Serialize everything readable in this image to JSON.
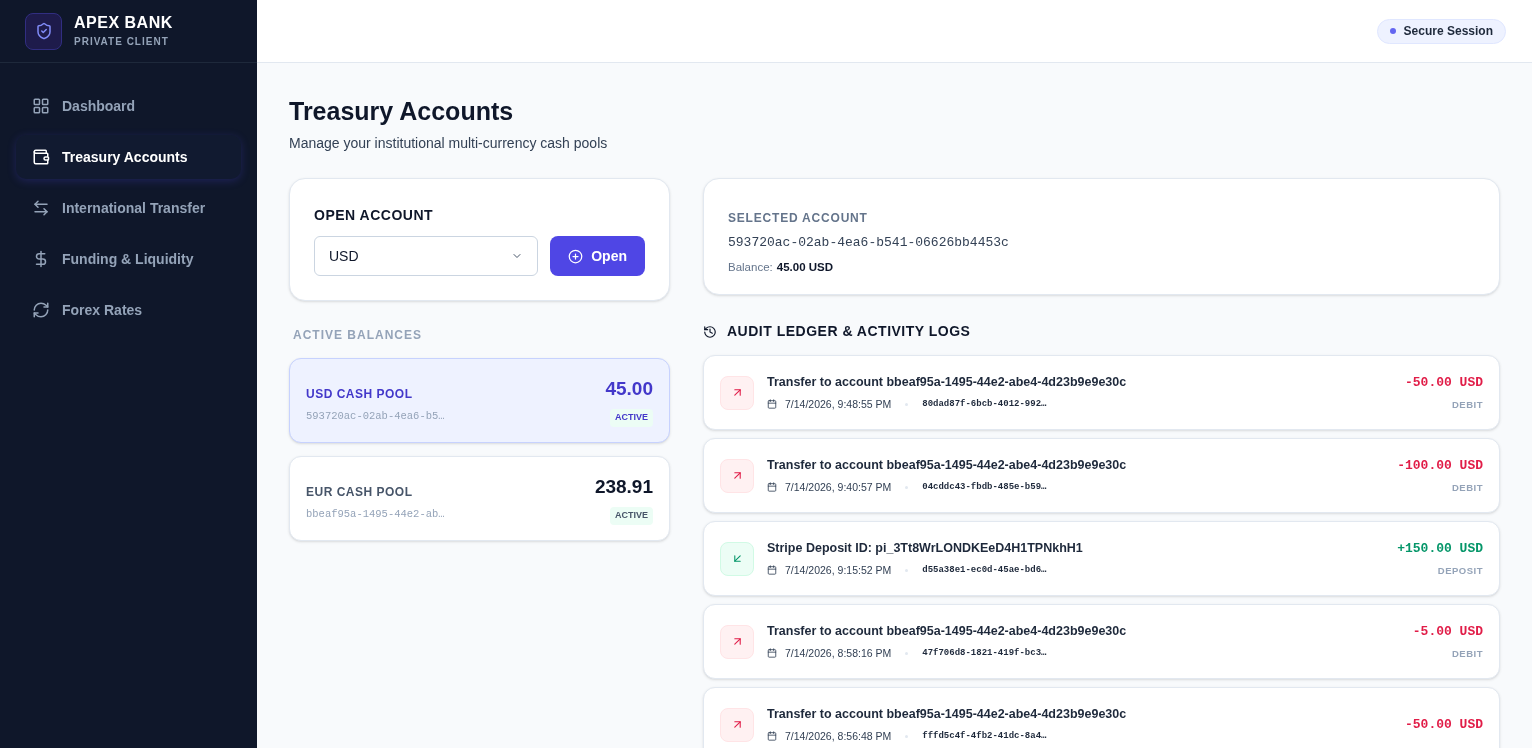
{
  "brand": {
    "name": "APEX BANK",
    "subtitle": "PRIVATE CLIENT"
  },
  "nav": [
    {
      "label": "Dashboard",
      "kind": "dashboard",
      "selected": false
    },
    {
      "label": "Treasury Accounts",
      "kind": "wallet",
      "selected": true
    },
    {
      "label": "International Transfer",
      "kind": "transfer",
      "selected": false
    },
    {
      "label": "Funding & Liquidity",
      "kind": "dollar",
      "selected": false
    },
    {
      "label": "Forex Rates",
      "kind": "refresh",
      "selected": false
    }
  ],
  "header": {
    "session_badge": "Secure Session"
  },
  "page": {
    "title": "Treasury Accounts",
    "subtitle": "Manage your institutional multi-currency cash pools"
  },
  "open_account": {
    "title": "OPEN ACCOUNT",
    "currency": "USD",
    "button": "Open"
  },
  "active_balances": {
    "title": "ACTIVE BALANCES",
    "accounts": [
      {
        "name": "USD CASH POOL",
        "id": "593720ac-02ab-4ea6-b5…",
        "balance": "45.00",
        "status": "ACTIVE",
        "selected": true
      },
      {
        "name": "EUR CASH POOL",
        "id": "bbeaf95a-1495-44e2-ab…",
        "balance": "238.91",
        "status": "ACTIVE",
        "selected": false
      }
    ]
  },
  "selected_account": {
    "label": "SELECTED ACCOUNT",
    "id": "593720ac-02ab-4ea6-b541-06626bb4453c",
    "balance_label": "Balance:",
    "balance": "45.00 USD"
  },
  "ledger": {
    "title": "AUDIT LEDGER & ACTIVITY LOGS",
    "entries": [
      {
        "kind": "debit",
        "description": "Transfer to account bbeaf95a-1495-44e2-abe4-4d23b9e9e30c",
        "date": "7/14/2026, 9:48:55 PM",
        "ref": "80dad87f-6bcb-4012-992…",
        "amount": "-50.00 USD",
        "type": "DEBIT"
      },
      {
        "kind": "debit",
        "description": "Transfer to account bbeaf95a-1495-44e2-abe4-4d23b9e9e30c",
        "date": "7/14/2026, 9:40:57 PM",
        "ref": "04cddc43-fbdb-485e-b59…",
        "amount": "-100.00 USD",
        "type": "DEBIT"
      },
      {
        "kind": "deposit",
        "description": "Stripe Deposit ID: pi_3Tt8WrLONDKEeD4H1TPNkhH1",
        "date": "7/14/2026, 9:15:52 PM",
        "ref": "d55a38e1-ec0d-45ae-bd6…",
        "amount": "+150.00 USD",
        "type": "DEPOSIT"
      },
      {
        "kind": "debit",
        "description": "Transfer to account bbeaf95a-1495-44e2-abe4-4d23b9e9e30c",
        "date": "7/14/2026, 8:58:16 PM",
        "ref": "47f706d8-1821-419f-bc3…",
        "amount": "-5.00 USD",
        "type": "DEBIT"
      },
      {
        "kind": "debit",
        "description": "Transfer to account bbeaf95a-1495-44e2-abe4-4d23b9e9e30c",
        "date": "7/14/2026, 8:56:48 PM",
        "ref": "fffd5c4f-4fb2-41dc-8a4…",
        "amount": "-50.00 USD"
      }
    ]
  }
}
